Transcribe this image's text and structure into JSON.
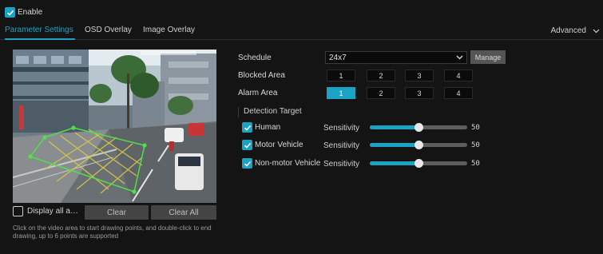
{
  "enable": {
    "label": "Enable",
    "checked": true
  },
  "tabs": [
    {
      "label": "Parameter Settings",
      "active": true
    },
    {
      "label": "OSD Overlay",
      "active": false
    },
    {
      "label": "Image Overlay",
      "active": false
    }
  ],
  "advanced": {
    "label": "Advanced",
    "icon": "chevron-down-icon"
  },
  "video": {
    "polygon_points": 6
  },
  "display_all": {
    "label": "Display all a…",
    "checked": false
  },
  "buttons": {
    "clear": "Clear",
    "clear_all": "Clear All"
  },
  "hint": "Click on the video area to start drawing points, and double-click to end drawing, up to 6 points are supported",
  "schedule": {
    "label": "Schedule",
    "value": "24x7",
    "manage": "Manage"
  },
  "blocked_area": {
    "label": "Blocked Area",
    "items": [
      "1",
      "2",
      "3",
      "4"
    ],
    "active": null
  },
  "alarm_area": {
    "label": "Alarm Area",
    "items": [
      "1",
      "2",
      "3",
      "4"
    ],
    "active": "1"
  },
  "detection_target": {
    "label": "Detection Target",
    "sensitivity_label": "Sensitivity",
    "items": [
      {
        "label": "Human",
        "checked": true,
        "sensitivity": 50
      },
      {
        "label": "Motor Vehicle",
        "checked": true,
        "sensitivity": 50
      },
      {
        "label": "Non-motor Vehicle",
        "checked": true,
        "sensitivity": 50
      }
    ]
  },
  "colors": {
    "accent": "#1aa3c4",
    "polygon": "#4fe04a"
  }
}
